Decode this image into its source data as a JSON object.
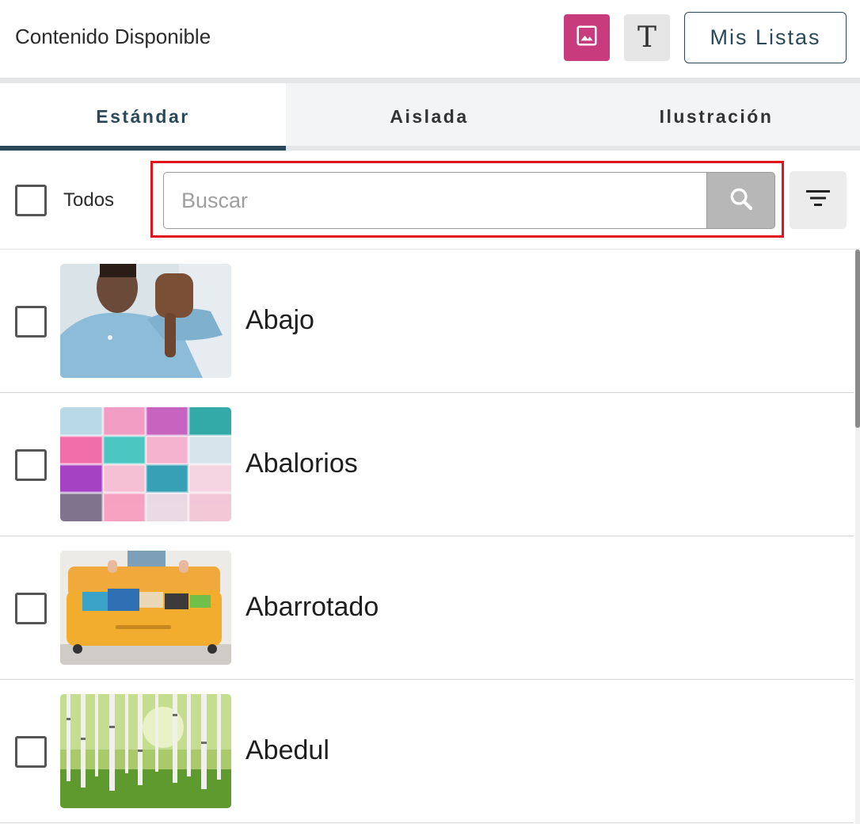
{
  "header": {
    "title": "Contenido Disponible",
    "image_mode_icon": "image-icon",
    "text_mode_glyph": "T",
    "lists_button": "Mis Listas",
    "accent_color": "#c83c7e",
    "brand_color": "#2a4858"
  },
  "tabs": [
    {
      "label": "Estándar",
      "active": true
    },
    {
      "label": "Aislada",
      "active": false
    },
    {
      "label": "Ilustración",
      "active": false
    }
  ],
  "toolbar": {
    "select_all_label": "Todos",
    "select_all_checked": false,
    "search": {
      "placeholder": "Buscar",
      "value": "",
      "icon": "search-icon",
      "highlight_color": "#e1141c"
    },
    "filter_icon": "filter-icon"
  },
  "items": [
    {
      "label": "Abajo",
      "checked": false,
      "image": "person-thumbs-down-photo"
    },
    {
      "label": "Abalorios",
      "checked": false,
      "image": "colorful-beads-photo"
    },
    {
      "label": "Abarrotado",
      "checked": false,
      "image": "packed-suitcase-photo"
    },
    {
      "label": "Abedul",
      "checked": false,
      "image": "birch-forest-photo"
    }
  ]
}
